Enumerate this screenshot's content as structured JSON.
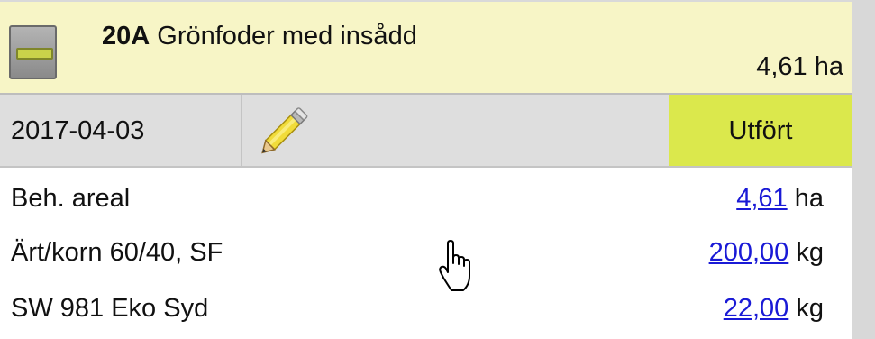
{
  "field": {
    "code": "20A",
    "name": "Grönfoder med insådd",
    "area": "4,61 ha"
  },
  "activity": {
    "date": "2017-04-03",
    "status": "Utfört"
  },
  "rows": [
    {
      "label": "Beh. areal",
      "value": "4,61",
      "unit": "ha"
    },
    {
      "label": "Ärt/korn 60/40, SF",
      "value": "200,00",
      "unit": "kg"
    },
    {
      "label": "SW 981 Eko Syd",
      "value": "22,00",
      "unit": "kg"
    }
  ],
  "icons": {
    "collapse": "minus-icon",
    "edit": "pencil-icon",
    "cursor": "hand-pointer-icon"
  },
  "colors": {
    "header_bg": "#f7f5c6",
    "activity_bg": "#dedede",
    "status_bg": "#dbe84c",
    "link": "#1a1ad6"
  }
}
